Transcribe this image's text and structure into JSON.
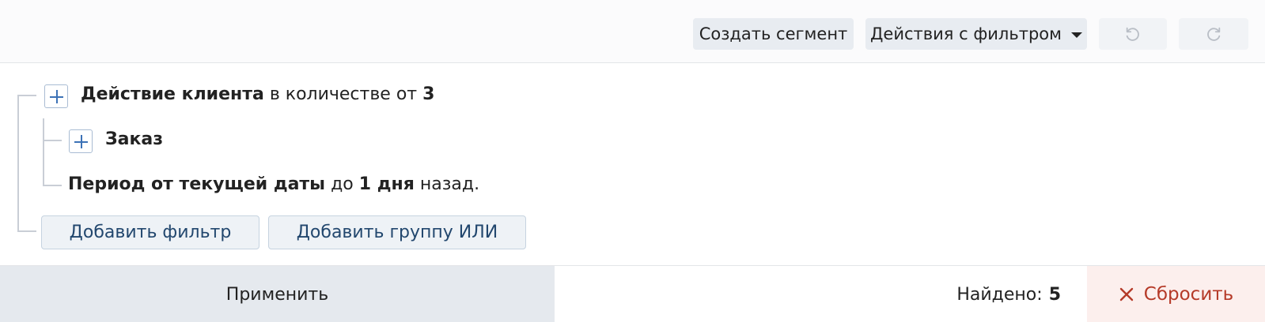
{
  "toolbar": {
    "create_segment_label": "Создать сегмент",
    "filter_actions_label": "Действия с фильтром",
    "undo_icon": "undo-icon",
    "redo_icon": "redo-icon"
  },
  "filter_tree": {
    "root": {
      "name": "Действие клиента",
      "qualifier": "в количестве от",
      "count": "3"
    },
    "child": {
      "name": "Заказ"
    },
    "period": {
      "name": "Период от текущей даты",
      "preposition": "до",
      "value": "1 дня",
      "suffix": "назад."
    },
    "add_filter_label": "Добавить фильтр",
    "add_or_group_label": "Добавить группу ИЛИ"
  },
  "footer": {
    "apply_label": "Применить",
    "found_label": "Найдено:",
    "found_count": "5",
    "reset_label": "Сбросить"
  },
  "colors": {
    "toolbar_button_bg": "#e8ecf1",
    "plus_accent": "#3c72b6",
    "reset_bg": "#fcefed",
    "reset_text": "#b53a28",
    "apply_bg": "#e5e9ee"
  }
}
